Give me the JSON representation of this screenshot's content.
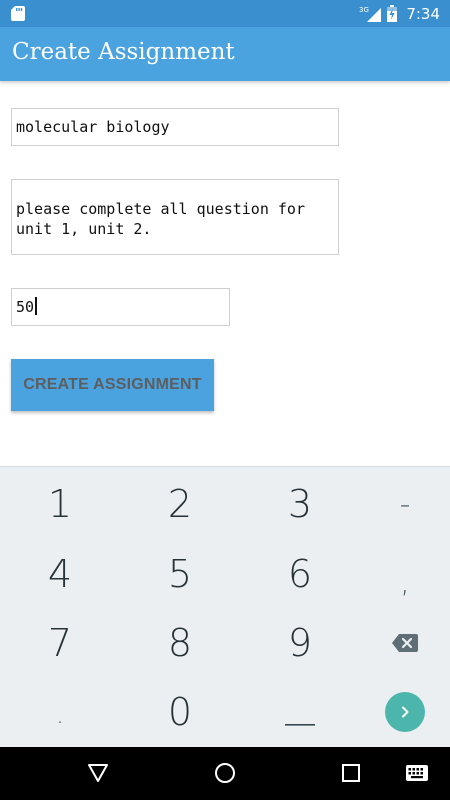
{
  "status_bar": {
    "network_label": "3G",
    "time": "7:34",
    "colors": {
      "background": "#3a8fcf"
    }
  },
  "app_bar": {
    "title": "Create Assignment",
    "color": "#4aa3df"
  },
  "form": {
    "title_value": "molecular biology",
    "description_value": "please complete all question for unit 1, unit 2.",
    "marks_value": "50",
    "submit_label": "CREATE ASSIGNMENT"
  },
  "keyboard": {
    "type": "numeric",
    "rows": [
      [
        "1",
        "2",
        "3",
        "-"
      ],
      [
        "4",
        "5",
        "6",
        ","
      ],
      [
        "7",
        "8",
        "9",
        "backspace-icon"
      ],
      [
        ".",
        "0",
        "space-bar",
        "go-icon"
      ]
    ],
    "go_color": "#4db6ac"
  },
  "nav_bar": {
    "buttons": [
      "back-icon",
      "home-icon",
      "recents-icon",
      "keyboard-switch-icon"
    ]
  }
}
